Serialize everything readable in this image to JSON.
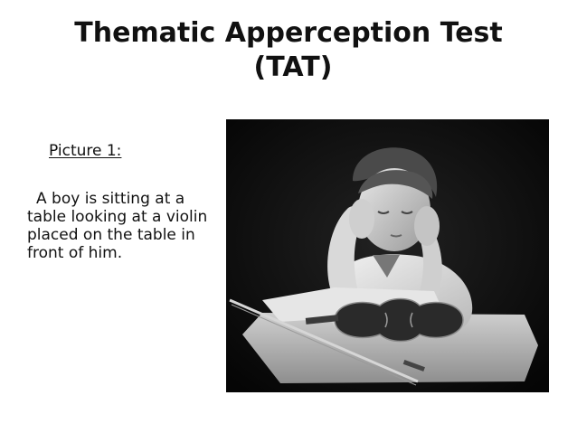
{
  "title": {
    "line1": "Thematic Apperception Test",
    "line2": "(TAT)"
  },
  "picture": {
    "label": "Picture 1:",
    "description": "A boy is sitting at a table looking at a violin placed on the table in front of him."
  },
  "image": {
    "subject": "boy-with-violin-photo"
  }
}
